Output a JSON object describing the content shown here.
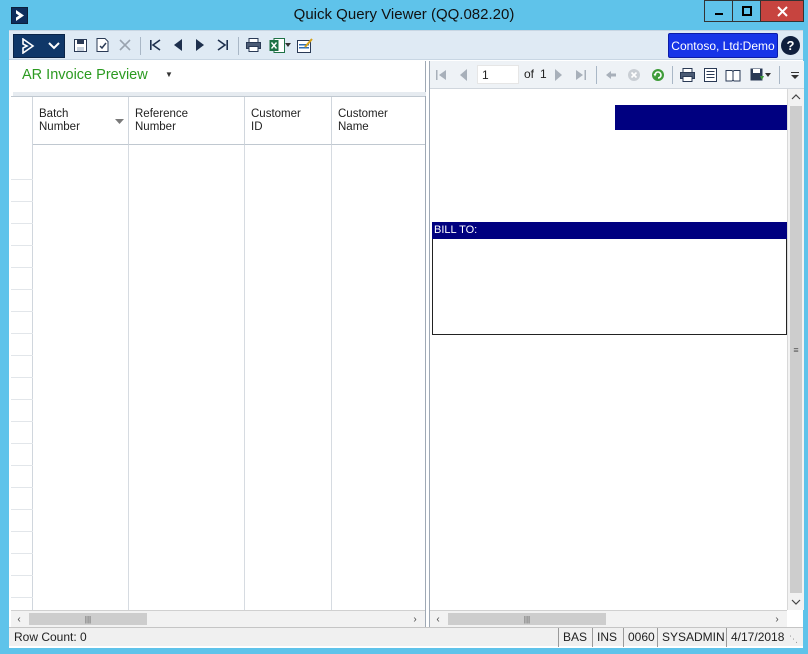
{
  "window": {
    "title": "Quick Query Viewer (QQ.082.20)",
    "colors": {
      "titlebar": "#5fc3ea",
      "close_button": "#c7443f"
    }
  },
  "toolbar": {
    "icons": [
      "nav-menu-icon",
      "save-icon",
      "save-as-icon",
      "delete-icon",
      "first-record-icon",
      "previous-record-icon",
      "next-record-icon",
      "last-record-icon",
      "print-icon",
      "excel-icon",
      "customize-icon"
    ],
    "company": "Contoso, Ltd:Demo",
    "help": "?",
    "colors": {
      "company_badge": "#1635e8",
      "nav_button": "#0f3768"
    }
  },
  "view": {
    "title": "AR Invoice Preview",
    "title_color": "#2b9a20"
  },
  "grid": {
    "columns": [
      {
        "line1": "Batch",
        "line2": "Number"
      },
      {
        "line1": "Reference",
        "line2": "Number"
      },
      {
        "line1": "Customer",
        "line2": "ID"
      },
      {
        "line1": "Customer",
        "line2": "Name"
      }
    ],
    "rows": []
  },
  "report": {
    "page_current": "1",
    "page_of": "of",
    "page_total": "1",
    "bill_to_label": "BILL TO:",
    "band_color": "#000080"
  },
  "statusbar": {
    "row_count": "Row Count: 0",
    "mode": "BAS",
    "insert": "INS",
    "code": "0060",
    "user": "SYSADMIN",
    "date": "4/17/2018"
  }
}
